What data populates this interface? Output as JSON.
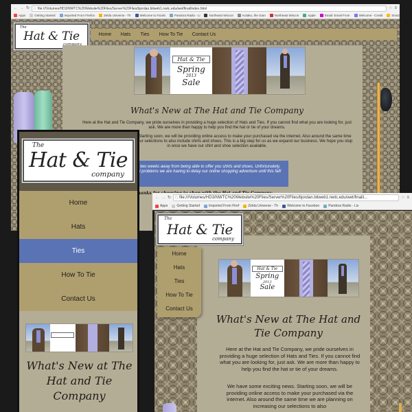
{
  "window1": {
    "url": "file:///Volumes/HD3/NWTC%20Website%20Files/Server%20Files/bjordan.bitweb1.nwtc.edu/wet/final/index.html",
    "bookmarks": [
      "Apps",
      "Getting Started",
      "Imported From Firefox",
      "Zelda Universe - Th",
      "Welcome to Faceb",
      "Pandora Radio - Li",
      "Northeast Wiscon",
      "Kotaku, the Gam",
      "Northeast Wiscon",
      "Apple",
      "Email: Email From",
      "Welcome - Credit",
      "Sms2",
      "TVShowsOnPrint.com"
    ],
    "logo": {
      "the": "The",
      "main": "Hat & Tie",
      "company": "company"
    },
    "nav": [
      "Home",
      "Hats",
      "Ties",
      "How To Tie",
      "Contact Us"
    ],
    "banner": {
      "logo_mini": "Hat & Tie",
      "sale_line1": "Spring",
      "sale_year": "2013",
      "sale_line2": "Sale"
    },
    "heading": "What's New at The Hat and Tie Company",
    "para1": "Here at the Hat and Tie Company, we pride ourselves in providing a huge selection of Hats and Ties. If you cannot find what you are looking for, just ask. We are more than happy to help you find the hat or tie of your dreams.",
    "para2": "We have some exciting news. Starting soon, we will be providing online access to make your purchased via the internet. Also around the same time we are planning on increasing our selections to also include shirts and shoes. This is a big step for us as we expand our business. We hope you stop in once we have our shirt and shoe selection available.",
    "update": "Update: We are only two weeks away from being able to offer you shirts and shoes. Unfortunately, due to a few technical problems we are having to delay our online shopping adventure until this fall!",
    "thanks": "Thanks for choosing to shop with the Hat and Tie Company"
  },
  "mobile": {
    "logo": {
      "the": "The",
      "main": "Hat & Tie",
      "company": "company"
    },
    "nav": [
      "Home",
      "Hats",
      "Ties",
      "How To Tie",
      "Contact Us"
    ],
    "active_nav": "Ties",
    "heading": "What's New at The Hat and Tie Company"
  },
  "window2": {
    "url": "file:///Volumes/HD3/NWTC%20Website%20Files/Server%20Files/bjordan.bitweb1.nwtc.edu/wet/final/i...",
    "bookmarks": [
      "Apps",
      "Getting Started",
      "Imported From Firef",
      "Zelda Universe - Th",
      "Welcome to Faceboo",
      "Pandora Radio - Lis"
    ],
    "logo": {
      "the": "The",
      "main": "Hat & Tie",
      "company": "company"
    },
    "nav": [
      "Home",
      "Hats",
      "Ties",
      "How To Tie",
      "Contact Us"
    ],
    "heading": "What's New at The Hat and Tie Company",
    "para1": "Here at the Hat and Tie Company, we pride ourselves in providing a huge selection of Hats and Ties. If you cannot find what you are looking for, just ask. We are more than happy to help you find the hat or tie of your dreams.",
    "para2": "We have some exciting news. Starting soon, we will be providing online access to make your purchased via the internet. Also around the same time we are planning on increasing our selections to also"
  },
  "colors": {
    "nav_gold": "#b09f6e",
    "content_bg": "#b4ad96",
    "active_blue": "#5a73b4",
    "dark_frame": "#5f5747"
  }
}
